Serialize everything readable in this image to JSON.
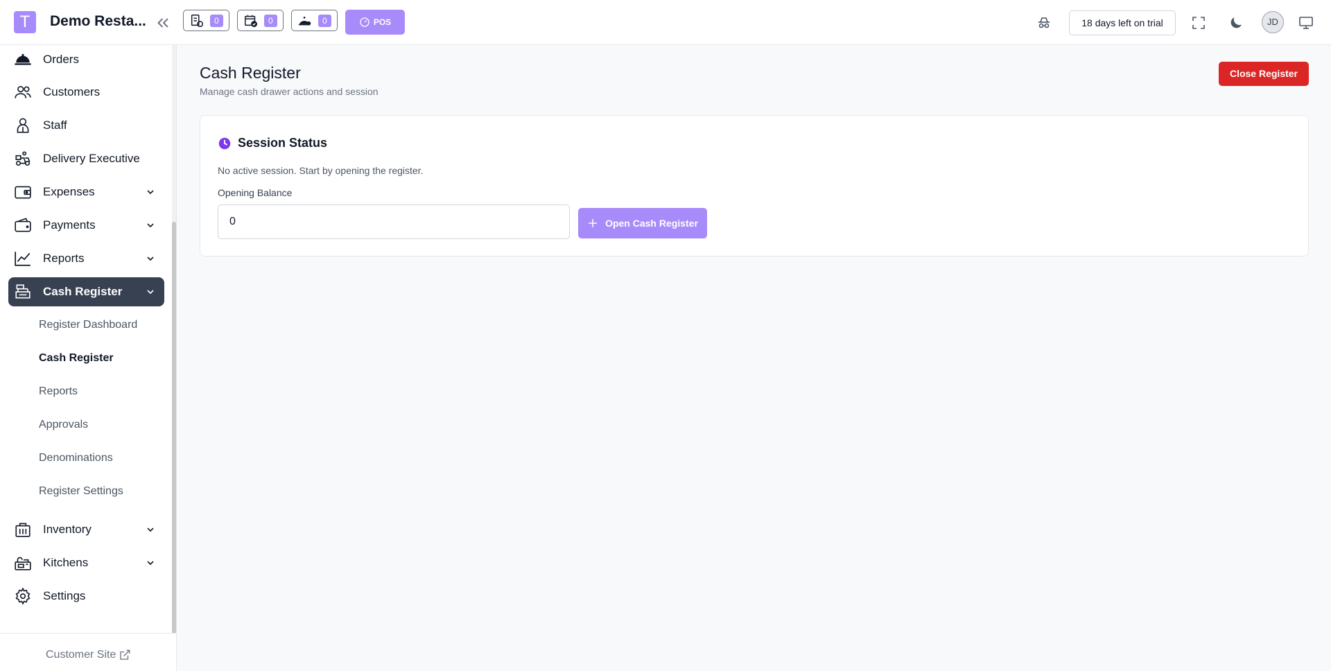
{
  "header": {
    "logo_letter": "T",
    "brand": "Demo Resta...",
    "badges": [
      {
        "icon": "order-bill-icon",
        "count": "0"
      },
      {
        "icon": "calendar-check-icon",
        "count": "0"
      },
      {
        "icon": "waiter-icon",
        "count": "0"
      }
    ],
    "pos_label": "POS",
    "trial_text": "18 days left on trial",
    "avatar_initials": "JD"
  },
  "sidebar": {
    "items": [
      {
        "label": "Orders",
        "icon": "cloche-icon"
      },
      {
        "label": "Customers",
        "icon": "users-icon"
      },
      {
        "label": "Staff",
        "icon": "staff-icon"
      },
      {
        "label": "Delivery Executive",
        "icon": "delivery-scooter-icon"
      },
      {
        "label": "Expenses",
        "icon": "wallet-icon"
      },
      {
        "label": "Payments",
        "icon": "payments-icon"
      },
      {
        "label": "Reports",
        "icon": "chart-line-icon"
      },
      {
        "label": "Cash Register",
        "icon": "cash-register-icon"
      },
      {
        "label": "Inventory",
        "icon": "inventory-icon"
      },
      {
        "label": "Kitchens",
        "icon": "kitchen-icon"
      },
      {
        "label": "Settings",
        "icon": "gear-icon"
      }
    ],
    "cash_register_sub": [
      "Register Dashboard",
      "Cash Register",
      "Reports",
      "Approvals",
      "Denominations",
      "Register Settings"
    ],
    "footer_link": "Customer Site"
  },
  "main": {
    "title": "Cash Register",
    "subtitle": "Manage cash drawer actions and session",
    "close_button": "Close Register",
    "card": {
      "title": "Session Status",
      "message": "No active session. Start by opening the register.",
      "field_label": "Opening Balance",
      "field_value": "0",
      "open_button": "Open Cash Register"
    }
  },
  "colors": {
    "accent": "#a78bfa",
    "accent_dark": "#7c3aed",
    "danger": "#dc2626",
    "sidebar_active": "#374151"
  }
}
